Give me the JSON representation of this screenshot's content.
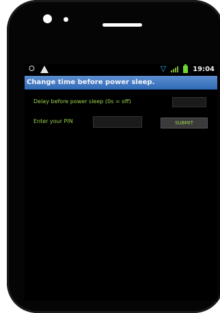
{
  "status_bar": {
    "time": "19:04",
    "icons": [
      "usb-icon",
      "warning-icon",
      "wifi-icon",
      "signal-icon",
      "battery-icon"
    ]
  },
  "app": {
    "title": "Change time before power sleep."
  },
  "form": {
    "delay_label": "Delay before power sleep (0s = off)",
    "delay_value": "",
    "pin_label": "Enter your PIN",
    "pin_value": "",
    "submit_label": "SUBMIT"
  },
  "colors": {
    "title_bar": "#3f7bc4",
    "label_text": "#9bd44c",
    "screen_background": "#000000"
  }
}
